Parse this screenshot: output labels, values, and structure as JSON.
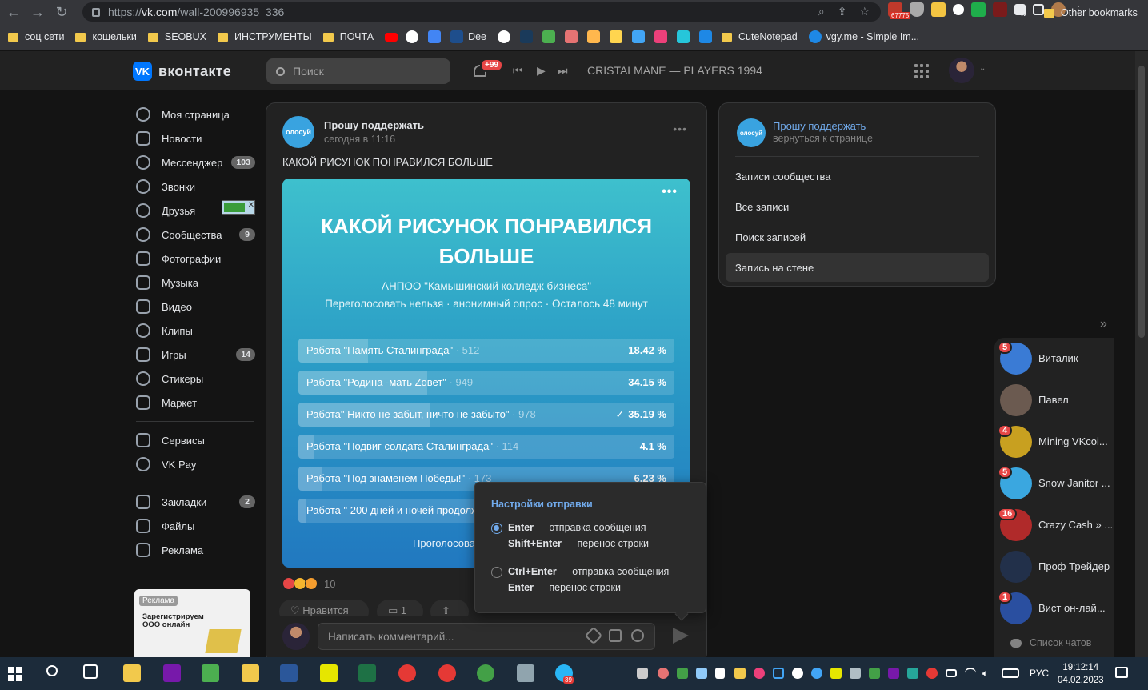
{
  "browser": {
    "url_scheme": "https://",
    "url_host": "vk.com",
    "url_path": "/wall-200996935_336",
    "ext_badge": "67775",
    "bookmarks": [
      {
        "label": "соц сети",
        "type": "folder"
      },
      {
        "label": "кошельки",
        "type": "folder"
      },
      {
        "label": "SEOBUX",
        "type": "folder"
      },
      {
        "label": "ИНСТРУМЕНТЫ",
        "type": "folder"
      },
      {
        "label": "ПОЧТА",
        "type": "folder"
      },
      {
        "label": "Dee",
        "type": "site"
      },
      {
        "label": "CuteNotepad",
        "type": "folder"
      },
      {
        "label": "vgy.me - Simple Im...",
        "type": "site"
      }
    ],
    "bookmarks_more": "»",
    "other_bookmarks": "Other bookmarks"
  },
  "header": {
    "logo_text": "вконтакте",
    "search_placeholder": "Поиск",
    "notif_badge": "+99",
    "now_playing": "CRISTALMANE — PLAYERS 1994"
  },
  "left_nav": {
    "items": [
      {
        "label": "Моя страница",
        "count": ""
      },
      {
        "label": "Новости",
        "count": ""
      },
      {
        "label": "Мессенджер",
        "count": "103"
      },
      {
        "label": "Звонки",
        "count": ""
      },
      {
        "label": "Друзья",
        "count": ""
      },
      {
        "label": "Сообщества",
        "count": "9"
      },
      {
        "label": "Фотографии",
        "count": ""
      },
      {
        "label": "Музыка",
        "count": ""
      },
      {
        "label": "Видео",
        "count": ""
      },
      {
        "label": "Клипы",
        "count": ""
      },
      {
        "label": "Игры",
        "count": "14"
      },
      {
        "label": "Стикеры",
        "count": ""
      },
      {
        "label": "Маркет",
        "count": ""
      }
    ],
    "items2": [
      {
        "label": "Сервисы",
        "count": ""
      },
      {
        "label": "VK Pay",
        "count": ""
      }
    ],
    "items3": [
      {
        "label": "Закладки",
        "count": "2"
      },
      {
        "label": "Файлы",
        "count": ""
      },
      {
        "label": "Реклама",
        "count": ""
      }
    ],
    "ad": {
      "label": "Реклама",
      "text": "Зарегистрируем ООО онлайн"
    }
  },
  "post": {
    "avatar_text": "олосуй",
    "author": "Прошу поддержать",
    "time": "сегодня в 11:16",
    "text": "КАКОЙ РИСУНОК ПОНРАВИЛСЯ БОЛЬШЕ",
    "poll": {
      "title": "КАКОЙ РИСУНОК ПОНРАВИЛСЯ БОЛЬШЕ",
      "owner": "АНПОО \"Камышинский колледж бизнеса\"",
      "meta": "Переголосовать нельзя · анонимный опрос · Осталось 48 минут",
      "vote_button": "Проголосова",
      "options": [
        {
          "label": "Работа \"Память Сталинграда\"",
          "count": "512",
          "percent": "18.42 %",
          "share": 18.42,
          "voted": false
        },
        {
          "label": "Работа \"Родина -мать Zовет\"",
          "count": "949",
          "percent": "34.15 %",
          "share": 34.15,
          "voted": false
        },
        {
          "label": "Работа\" Никто не забыт, ничто не забыто\"",
          "count": "978",
          "percent": "35.19 %",
          "share": 35.19,
          "voted": true,
          "check": "✓"
        },
        {
          "label": "Работа \"Подвиг солдата Сталинграда\"",
          "count": "114",
          "percent": "4.1 %",
          "share": 4.1,
          "voted": false
        },
        {
          "label": "Работа \"Под знаменем Победы!\"",
          "count": "173",
          "percent": "6.23 %",
          "share": 6.23,
          "voted": false
        },
        {
          "label": "Работа \" 200 дней и ночей продолж",
          "count": "",
          "percent": "",
          "share": 1.9,
          "voted": false
        }
      ]
    },
    "reactions_count": "10",
    "like_label": "Нравится",
    "comments_count": "1",
    "comment_placeholder": "Написать комментарий..."
  },
  "send_popup": {
    "title": "Настройки отправки",
    "option1_line1_key": "Enter",
    "option1_line1_text": " — отправка сообщения",
    "option1_line2_key": "Shift+Enter",
    "option1_line2_text": " — перенос строки",
    "option2_line1_key": "Ctrl+Enter",
    "option2_line1_text": " — отправка сообщения",
    "option2_line2_key": "Enter",
    "option2_line2_text": " — перенос строки"
  },
  "right_menu": {
    "avatar_text": "олосуй",
    "name": "Прошу поддержать",
    "back": "вернуться к странице",
    "items": [
      "Записи сообщества",
      "Все записи",
      "Поиск записей",
      "Запись на стене"
    ]
  },
  "chats": {
    "items": [
      {
        "name": "Виталик",
        "badge": "5",
        "color": "#3a7bd5"
      },
      {
        "name": "Павел",
        "badge": "",
        "color": "#6b5a50"
      },
      {
        "name": "Mining VKcoi...",
        "badge": "4",
        "color": "#c8a020"
      },
      {
        "name": "Snow Janitor ...",
        "badge": "5",
        "color": "#3aa7e0"
      },
      {
        "name": "Crazy Cash » ...",
        "badge": "16",
        "color": "#b02a2a"
      },
      {
        "name": "Проф Трейдер",
        "badge": "",
        "color": "#22304a"
      },
      {
        "name": "Вист он-лай...",
        "badge": "1",
        "color": "#2a4fa0"
      }
    ],
    "list_label": "Список чатов"
  },
  "taskbar": {
    "lang": "РУС",
    "time": "19:12:14",
    "date": "04.02.2023",
    "telegram_badge": "39"
  }
}
